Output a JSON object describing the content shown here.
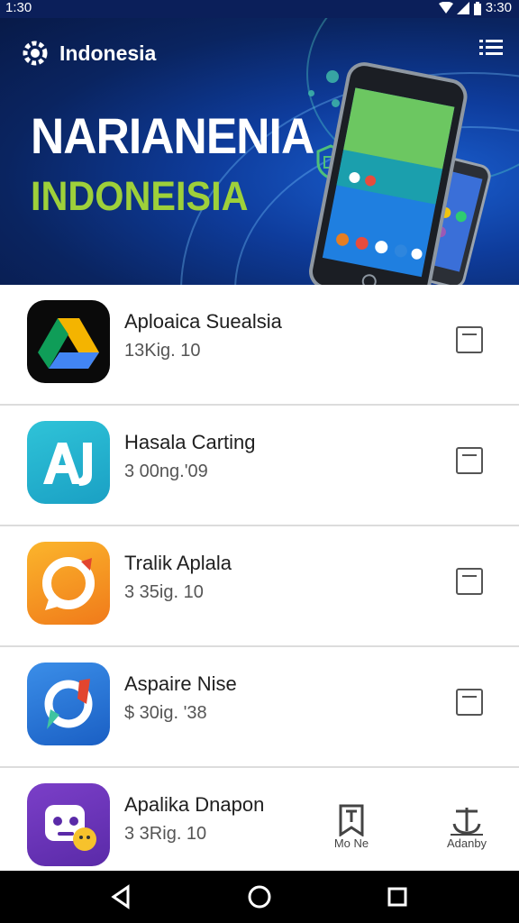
{
  "status_bar": {
    "time_left": "1:30",
    "time_right": "3:30"
  },
  "header": {
    "brand": "Indonesia"
  },
  "hero": {
    "headline_1": "NARIANENIA",
    "headline_2": "INDONEISIA"
  },
  "apps": [
    {
      "name": "Aploaica Suealsia",
      "meta": "13Kig. 10",
      "icon": "drive-icon"
    },
    {
      "name": "Hasala Carting",
      "meta": "3 00ng.'09",
      "icon": "aj-icon"
    },
    {
      "name": "Tralik Aplala",
      "meta": "3 35ig. 10",
      "icon": "orange-ring-icon"
    },
    {
      "name": "Aspaire Nise",
      "meta": "$ 30ig. '38",
      "icon": "compass-icon"
    },
    {
      "name": "Apalika Dnapon",
      "meta": "3 3Rig. 10",
      "icon": "robot-icon"
    }
  ],
  "bottom_tabs": [
    {
      "label": "Mo Ne",
      "icon": "bookmark-icon"
    },
    {
      "label": "Adanby",
      "icon": "anchor-icon"
    }
  ],
  "colors": {
    "hero_bg": "#0e3c9c",
    "accent_green": "#9ed03a"
  }
}
